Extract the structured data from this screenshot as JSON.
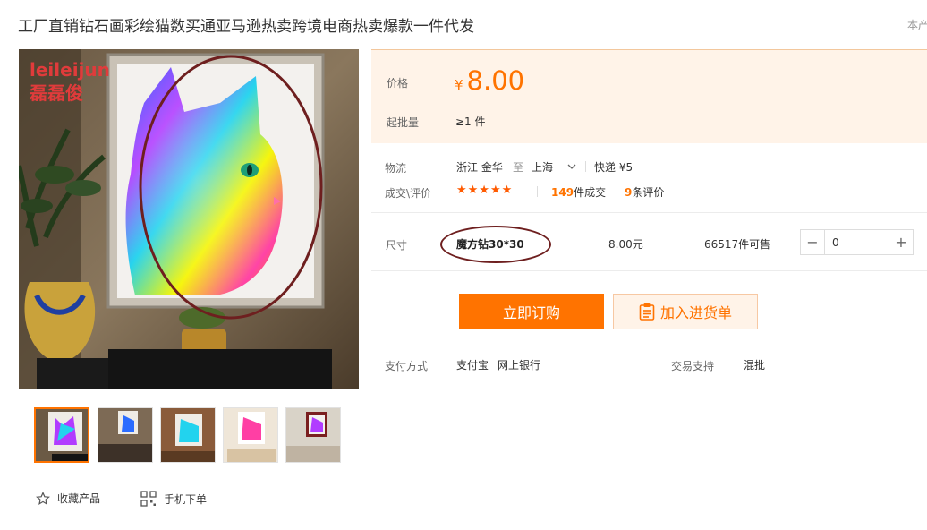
{
  "product": {
    "title": "工厂直销钻石画彩绘猫数买通亚马逊热卖跨境电商热卖爆款一件代发",
    "corner_text": "本产"
  },
  "watermark": {
    "line1": "leileijun",
    "line2": "磊磊俊"
  },
  "price": {
    "label": "价格",
    "currency": "¥",
    "value": "8.00"
  },
  "min_order": {
    "label": "起批量",
    "value": "≥1 件"
  },
  "logistics": {
    "label": "物流",
    "origin": "浙江 金华",
    "to": "至",
    "destination": "上海",
    "shipping": "快递 ¥5"
  },
  "deals": {
    "label": "成交\\评价",
    "stars": "★★★★★",
    "rating": 5,
    "sold_count": "149",
    "sold_label": "件成交",
    "review_count": "9",
    "review_label": "条评价"
  },
  "sku": {
    "label": "尺寸",
    "name": "魔方钻30*30",
    "price": "8.00元",
    "stock": "66517件可售",
    "quantity": "0",
    "minus": "−",
    "plus": "+"
  },
  "actions": {
    "buy_now": "立即订购",
    "add_to_list": "加入进货单"
  },
  "payment": {
    "label": "支付方式",
    "methods": [
      "支付宝",
      "网上银行"
    ]
  },
  "trade": {
    "label": "交易支持",
    "value": "混批"
  },
  "footer": {
    "favorite": "收藏产品",
    "mobile_order": "手机下单"
  },
  "colors": {
    "accent": "#ff7300",
    "price_bg": "#fff3e8",
    "annotation": "#6e1f1f"
  },
  "icons": {
    "star": "star-outline-icon",
    "qr": "qr-code-icon",
    "cart": "clipboard-list-icon",
    "chevron": "chevron-down-icon"
  }
}
